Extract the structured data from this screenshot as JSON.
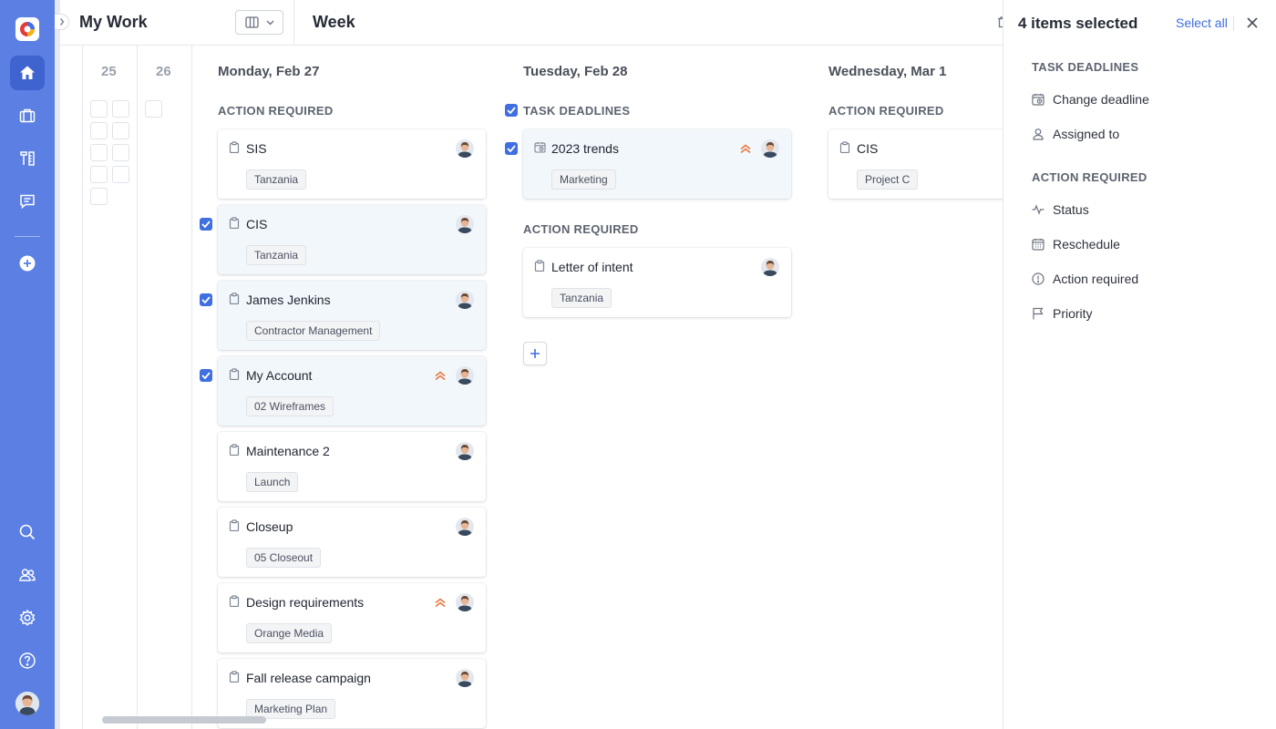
{
  "colors": {
    "rail": "#5b7fe3",
    "rail_active": "#3f63cf",
    "accent": "#3f6fe0",
    "priority": "#e8743b",
    "selected_card": "#f1f7fb"
  },
  "rail": {
    "logo_icon": "app-logo-icon",
    "top_items": [
      {
        "name": "home",
        "icon": "home-icon",
        "active": true
      },
      {
        "name": "projects",
        "icon": "briefcase-icon",
        "active": false
      },
      {
        "name": "tools",
        "icon": "tools-icon",
        "active": false
      },
      {
        "name": "messages",
        "icon": "chat-icon",
        "active": false
      },
      {
        "name": "add",
        "icon": "plus-circle-icon",
        "active": false
      }
    ],
    "bottom_items": [
      {
        "name": "search",
        "icon": "search-icon"
      },
      {
        "name": "people",
        "icon": "people-icon"
      },
      {
        "name": "settings",
        "icon": "gear-icon"
      },
      {
        "name": "help",
        "icon": "help-icon"
      }
    ]
  },
  "header": {
    "title": "My Work",
    "view_title": "Week"
  },
  "mini_days": [
    "25",
    "26"
  ],
  "days": [
    {
      "label": "Monday, Feb 27"
    },
    {
      "label": "Tuesday, Feb 28"
    },
    {
      "label": "Wednesday, Mar 1"
    }
  ],
  "sections": {
    "action_required": "ACTION REQUIRED",
    "task_deadlines": "TASK DEADLINES"
  },
  "monday_cards": [
    {
      "title": "SIS",
      "tag": "Tanzania",
      "selected": false,
      "priority": false
    },
    {
      "title": "CIS",
      "tag": "Tanzania",
      "selected": true,
      "priority": false
    },
    {
      "title": "James Jenkins",
      "tag": "Contractor Management",
      "selected": true,
      "priority": false
    },
    {
      "title": "My Account",
      "tag": "02 Wireframes",
      "selected": true,
      "priority": true
    },
    {
      "title": "Maintenance 2",
      "tag": "Launch",
      "selected": false,
      "priority": false
    },
    {
      "title": "Closeup",
      "tag": "05 Closeout",
      "selected": false,
      "priority": false
    },
    {
      "title": "Design requirements",
      "tag": "Orange Media",
      "selected": false,
      "priority": true
    },
    {
      "title": "Fall release campaign",
      "tag": "Marketing Plan",
      "selected": false,
      "priority": false
    }
  ],
  "tuesday_deadline_cards": [
    {
      "title": "2023 trends",
      "tag": "Marketing",
      "selected": true,
      "priority": true
    }
  ],
  "tuesday_action_cards": [
    {
      "title": "Letter of intent",
      "tag": "Tanzania",
      "selected": false,
      "priority": false
    }
  ],
  "wednesday_action_cards": [
    {
      "title": "CIS",
      "tag": "Project C",
      "selected": false,
      "priority": false
    }
  ],
  "panel": {
    "title": "4 items selected",
    "select_all": "Select all",
    "task_deadlines_heading": "TASK DEADLINES",
    "task_deadlines_items": [
      {
        "label": "Change deadline",
        "icon": "calendar-clock-icon"
      },
      {
        "label": "Assigned to",
        "icon": "person-icon"
      }
    ],
    "action_required_heading": "ACTION REQUIRED",
    "action_required_items": [
      {
        "label": "Status",
        "icon": "pulse-icon"
      },
      {
        "label": "Reschedule",
        "icon": "calendar-icon"
      },
      {
        "label": "Action required",
        "icon": "alert-circle-icon"
      },
      {
        "label": "Priority",
        "icon": "flag-icon"
      }
    ]
  }
}
